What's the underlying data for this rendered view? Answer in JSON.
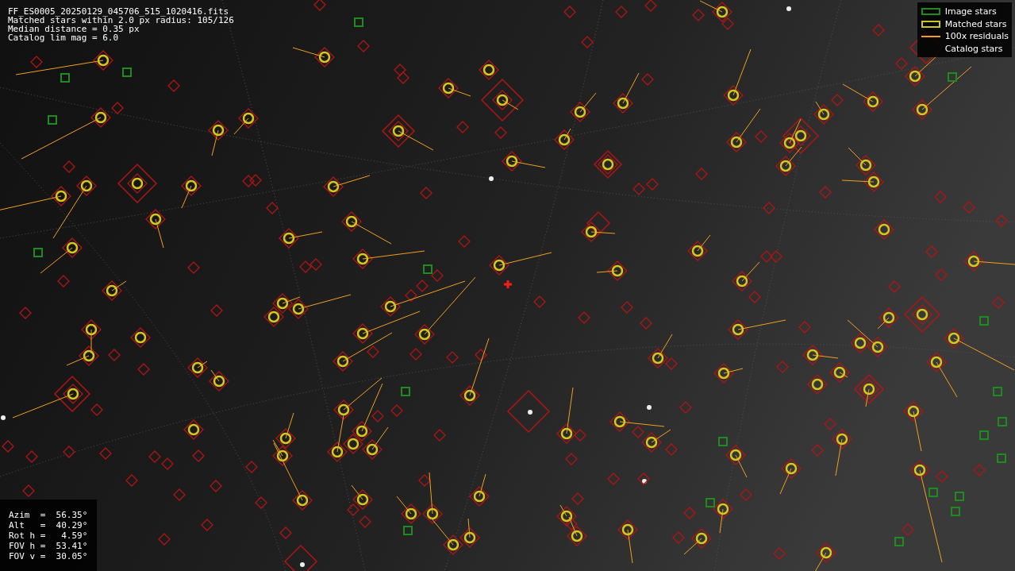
{
  "info_lines": [
    "FF_ES0005_20250129_045706_515_1020416.fits",
    "Matched stars within 2.0 px radius: 105/126",
    "Median distance = 0.35 px",
    "Catalog lim mag = 6.0"
  ],
  "legend": [
    {
      "kind": "image",
      "label": "Image stars"
    },
    {
      "kind": "matched",
      "label": "Matched stars"
    },
    {
      "kind": "residual",
      "label": "100x residuals"
    },
    {
      "kind": "catalog",
      "label": "Catalog stars"
    }
  ],
  "telemetry": [
    "Azim  =  56.35°",
    "Alt   =  40.29°",
    "Rot h =   4.59°",
    "FOV h =  53.41°",
    "FOV v =  30.05°"
  ]
}
